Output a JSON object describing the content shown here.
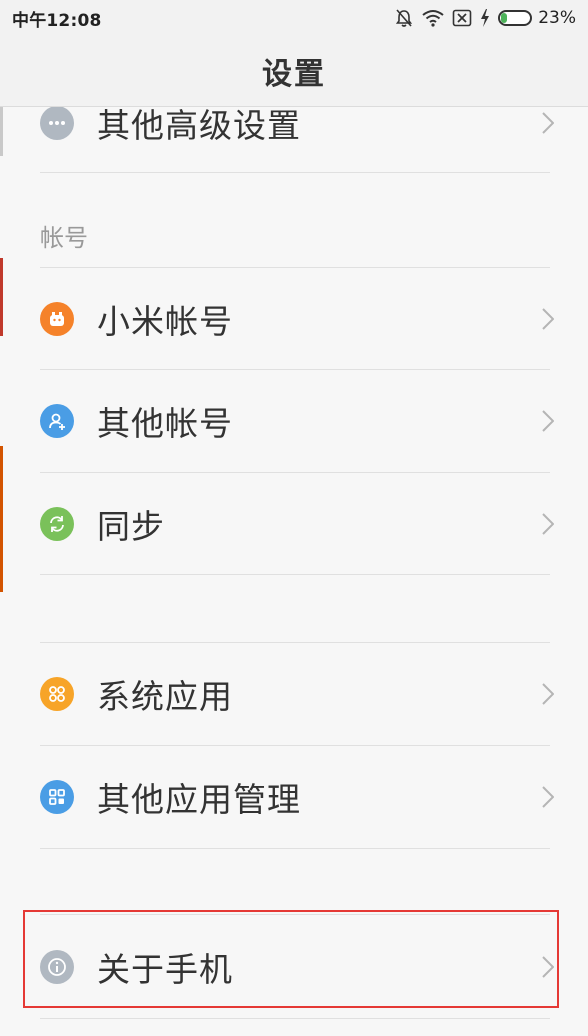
{
  "status_bar": {
    "time": "中午12:08",
    "battery_percent_text": "23%",
    "battery_level": 0.23,
    "icons": [
      "bell-off-icon",
      "wifi-icon",
      "sim-none-icon",
      "charging-icon",
      "battery-icon"
    ]
  },
  "header": {
    "title": "设置"
  },
  "items": {
    "other_advanced": {
      "label": "其他高级设置",
      "icon": "more-dots-icon",
      "color": "#b0b8c1"
    },
    "mi_account": {
      "label": "小米帐号",
      "icon": "mi-account-icon",
      "color": "#f5822a"
    },
    "other_accounts": {
      "label": "其他帐号",
      "icon": "add-user-icon",
      "color": "#4a9de5"
    },
    "sync": {
      "label": "同步",
      "icon": "sync-icon",
      "color": "#7ac15a"
    },
    "system_apps": {
      "label": "系统应用",
      "icon": "apps-grid-icon",
      "color": "#f7a428"
    },
    "other_app_mgmt": {
      "label": "其他应用管理",
      "icon": "app-manage-icon",
      "color": "#4a9de5"
    },
    "about_phone": {
      "label": "关于手机",
      "icon": "info-icon",
      "color": "#b0b8c1"
    }
  },
  "sections": {
    "accounts_header": "帐号"
  },
  "colors": {
    "highlight": "#e53935",
    "chevron": "#b5b5b5",
    "divider": "#e0e0e0"
  }
}
